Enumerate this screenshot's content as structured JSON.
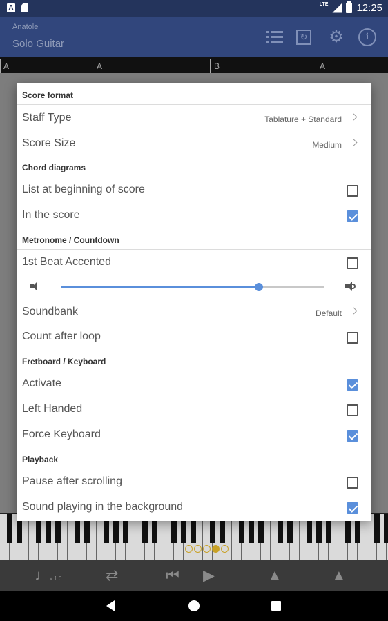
{
  "status_bar": {
    "time": "12:25",
    "network": "LTE"
  },
  "app_bar": {
    "subtitle": "Anatole",
    "title": "Solo Guitar"
  },
  "ruler": {
    "labels": [
      "A",
      "A",
      "B",
      "A"
    ]
  },
  "settings": {
    "sections": {
      "score_format": "Score format",
      "chord_diagrams": "Chord diagrams",
      "metronome": "Metronome / Countdown",
      "fretboard": "Fretboard / Keyboard",
      "playback": "Playback"
    },
    "staff_type": {
      "label": "Staff Type",
      "value": "Tablature + Standard"
    },
    "score_size": {
      "label": "Score Size",
      "value": "Medium"
    },
    "list_beginning": {
      "label": "List at beginning of score",
      "checked": false
    },
    "in_score": {
      "label": "In the score",
      "checked": true
    },
    "first_beat": {
      "label": "1st Beat Accented",
      "checked": false
    },
    "volume": {
      "level": 0.75
    },
    "soundbank": {
      "label": "Soundbank",
      "value": "Default"
    },
    "count_after_loop": {
      "label": "Count after loop",
      "checked": false
    },
    "activate": {
      "label": "Activate",
      "checked": true
    },
    "left_handed": {
      "label": "Left Handed",
      "checked": false
    },
    "force_keyboard": {
      "label": "Force Keyboard",
      "checked": true
    },
    "pause_scrolling": {
      "label": "Pause after scrolling",
      "checked": false
    },
    "sound_background": {
      "label": "Sound playing in the background",
      "checked": true
    }
  },
  "toolbar": {
    "speed": "x 1.0"
  },
  "colors": {
    "accent": "#5a8fdb",
    "app_bar": "#31467c",
    "status_bar": "#24345c"
  }
}
